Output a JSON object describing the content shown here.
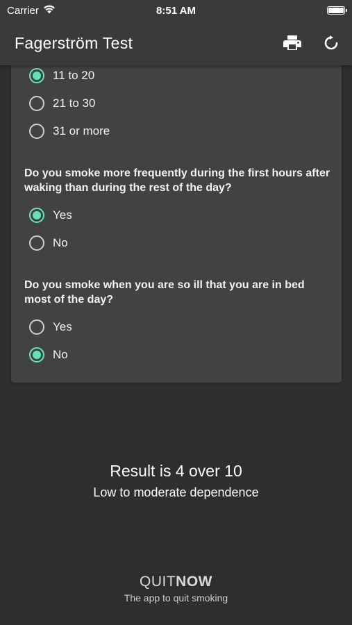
{
  "status_bar": {
    "carrier": "Carrier",
    "time": "8:51 AM"
  },
  "app_bar": {
    "title": "Fagerström Test",
    "actions": [
      "print-icon",
      "refresh-icon"
    ]
  },
  "questions": [
    {
      "text": "",
      "options": [
        {
          "label": "11 to 20",
          "checked": true
        },
        {
          "label": "21 to 30",
          "checked": false
        },
        {
          "label": "31 or more",
          "checked": false
        }
      ]
    },
    {
      "text": "Do you smoke more frequently during the first hours after waking than during the rest of the day?",
      "options": [
        {
          "label": "Yes",
          "checked": true
        },
        {
          "label": "No",
          "checked": false
        }
      ]
    },
    {
      "text": "Do you smoke when you are so ill that you are in bed most of the day?",
      "options": [
        {
          "label": "Yes",
          "checked": false
        },
        {
          "label": "No",
          "checked": true
        }
      ]
    }
  ],
  "result": {
    "title": "Result is 4 over 10",
    "description": "Low to moderate dependence"
  },
  "footer": {
    "logo_part1": "QUIT",
    "logo_part2": "NOW",
    "tagline": "The app to quit smoking"
  },
  "colors": {
    "accent": "#64e3b5",
    "background": "#2e2e2e",
    "card": "#424242",
    "app_bar": "#3a3a3a"
  }
}
